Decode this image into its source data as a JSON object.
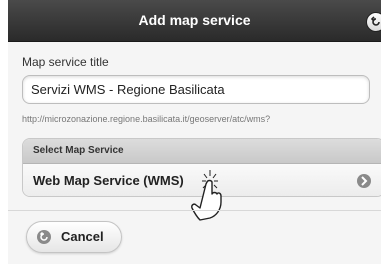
{
  "dialog": {
    "title": "Add map service",
    "corner_icon": "back-arrow-icon"
  },
  "form": {
    "title_label": "Map service title",
    "title_value": "Servizi WMS - Regione Basilicata",
    "url": "http://microzonazione.regione.basilicata.it/geoserver/atc/wms?"
  },
  "select": {
    "header": "Select Map Service",
    "option": "Web Map Service (WMS)",
    "option_icon": "chevron-right-icon"
  },
  "cursor": {
    "icon": "hand-pointer-icon"
  },
  "footer": {
    "cancel_label": "Cancel",
    "cancel_icon": "back-arrow-icon"
  }
}
